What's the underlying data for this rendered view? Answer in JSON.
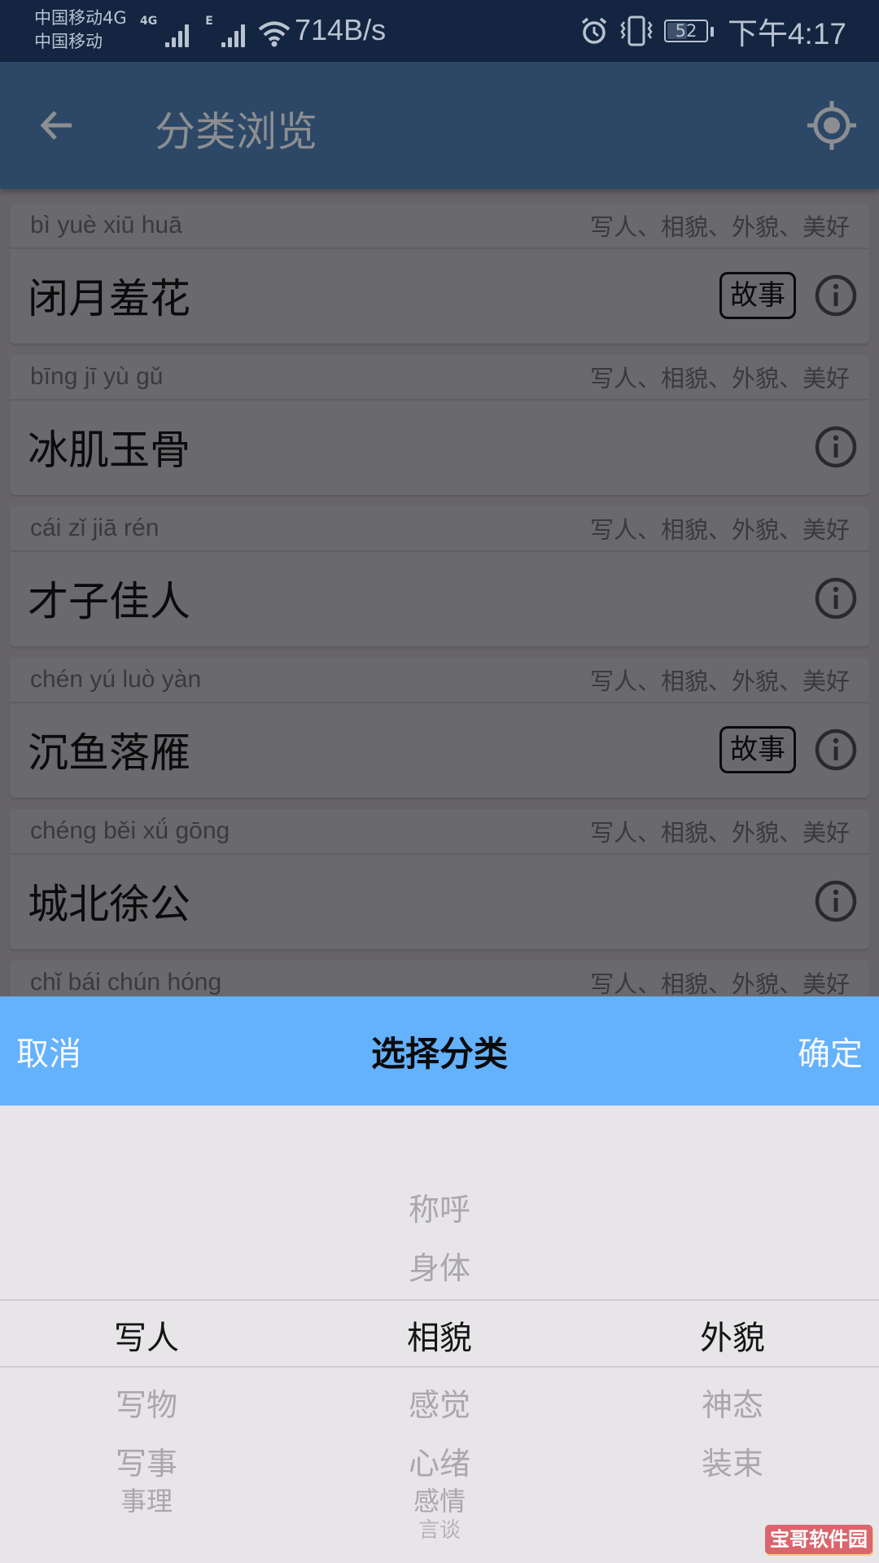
{
  "status_bar": {
    "carrier_1": "中国移动4G",
    "carrier_2": "中国移动",
    "sim1_tag": "4G",
    "sim2_tag": "E",
    "net_speed": "714B/s",
    "battery_level": "52",
    "battery_percent": 52,
    "time": "下午4:17"
  },
  "app_bar": {
    "title": "分类浏览",
    "back_icon": "arrow-left",
    "action_icon": "locate-target"
  },
  "list": [
    {
      "pinyin": "bì yuè xiū huā",
      "categories": "写人、相貌、外貌、美好",
      "idiom": "闭月羞花",
      "has_story": true
    },
    {
      "pinyin": "bīng jī yù gǔ",
      "categories": "写人、相貌、外貌、美好",
      "idiom": "冰肌玉骨",
      "has_story": false
    },
    {
      "pinyin": "cái zǐ jiā rén",
      "categories": "写人、相貌、外貌、美好",
      "idiom": "才子佳人",
      "has_story": false
    },
    {
      "pinyin": "chén yú luò yàn",
      "categories": "写人、相貌、外貌、美好",
      "idiom": "沉鱼落雁",
      "has_story": true
    },
    {
      "pinyin": "chéng běi xǘ gōng",
      "categories": "写人、相貌、外貌、美好",
      "idiom": "城北徐公",
      "has_story": false
    },
    {
      "pinyin": "chǐ bái chún hóng",
      "categories": "写人、相貌、外貌、美好",
      "idiom": "",
      "has_story": false
    }
  ],
  "story_label": "故事",
  "picker": {
    "cancel_label": "取消",
    "title": "选择分类",
    "confirm_label": "确定",
    "columns": [
      {
        "above": [],
        "selected": "写人",
        "below": [
          "写物",
          "写事",
          "事理"
        ]
      },
      {
        "above": [
          "称呼",
          "身体"
        ],
        "selected": "相貌",
        "below": [
          "感觉",
          "心绪",
          "感情",
          "言谈"
        ]
      },
      {
        "above": [],
        "selected": "外貌",
        "below": [
          "神态",
          "装束"
        ]
      }
    ]
  },
  "watermark": "宝哥软件园"
}
